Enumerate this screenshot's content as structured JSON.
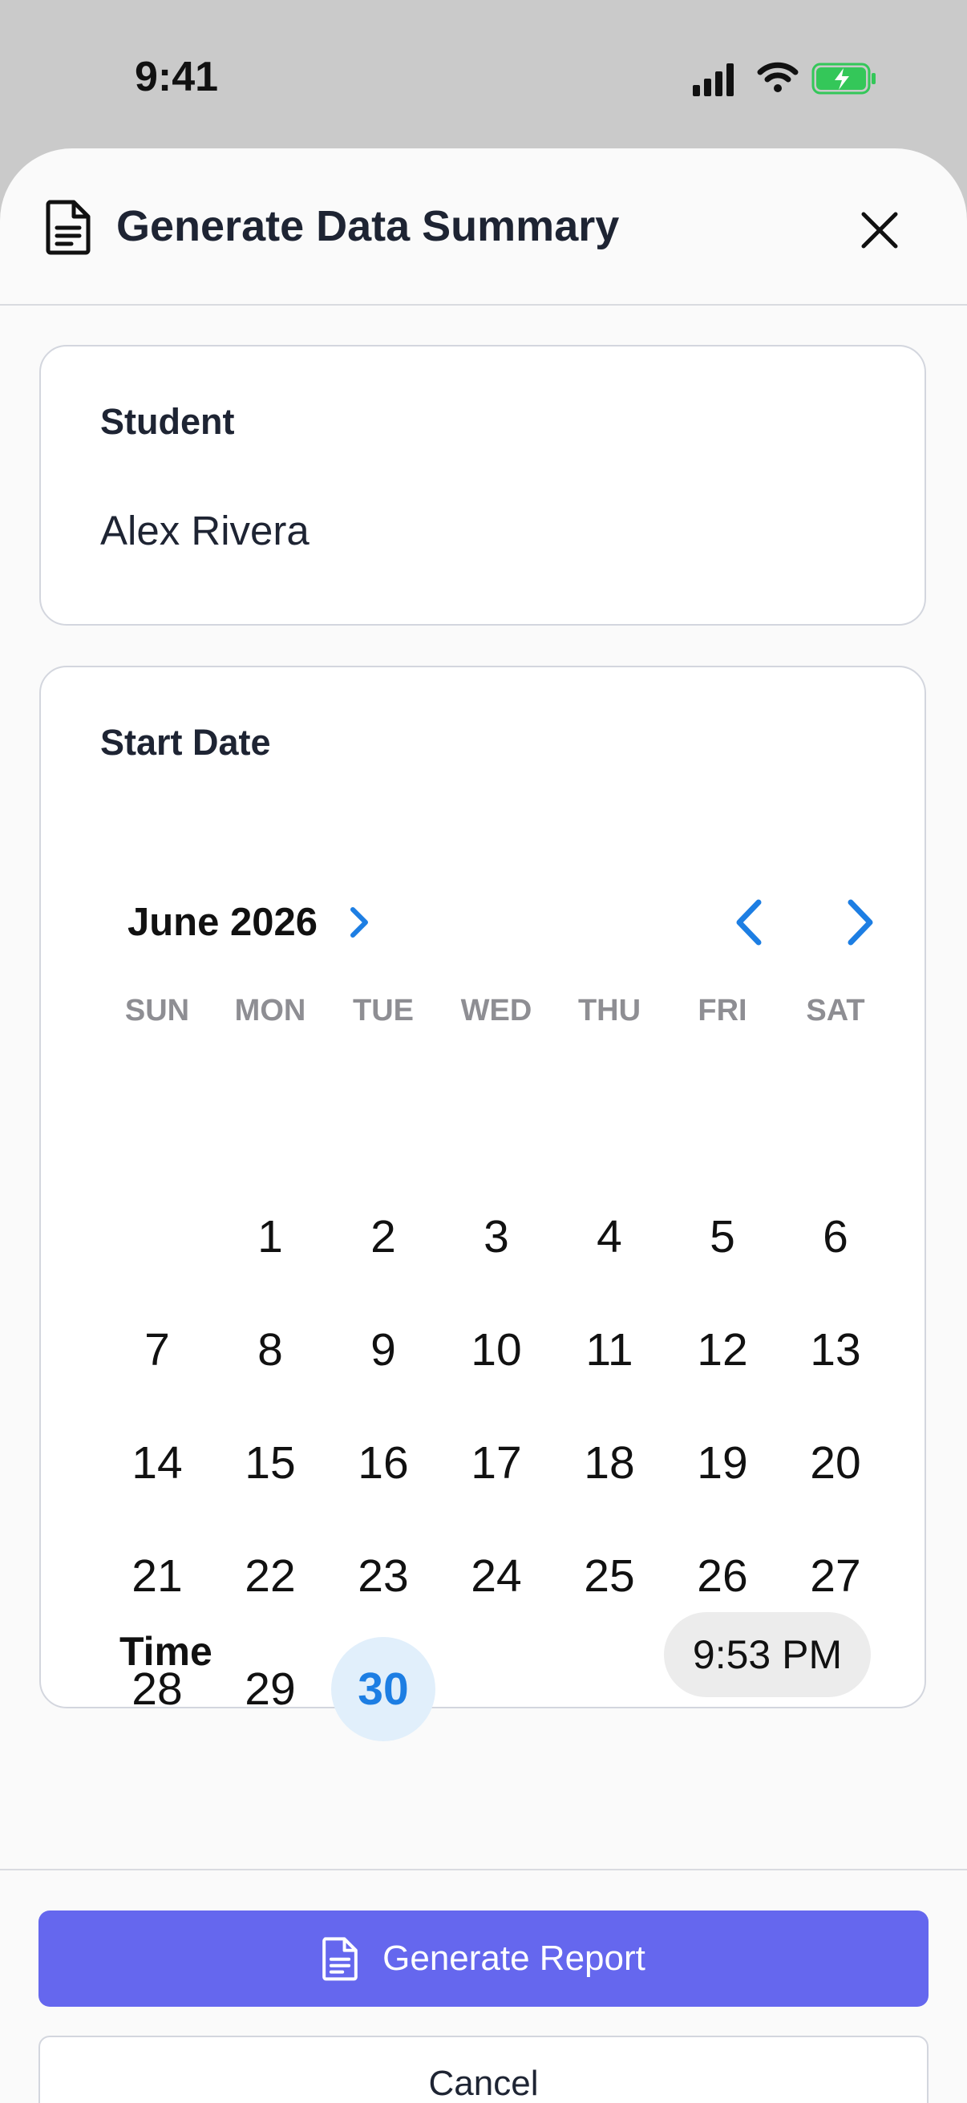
{
  "status_bar": {
    "time": "9:41"
  },
  "sheet": {
    "title": "Generate Data Summary"
  },
  "student": {
    "label": "Student",
    "value": "Alex Rivera"
  },
  "start_date": {
    "label": "Start Date",
    "month": "June 2026",
    "weekdays": [
      "SUN",
      "MON",
      "TUE",
      "WED",
      "THU",
      "FRI",
      "SAT"
    ],
    "days": [
      "1",
      "2",
      "3",
      "4",
      "5",
      "6",
      "7",
      "8",
      "9",
      "10",
      "11",
      "12",
      "13",
      "14",
      "15",
      "16",
      "17",
      "18",
      "19",
      "20",
      "21",
      "22",
      "23",
      "24",
      "25",
      "26",
      "27",
      "28",
      "29",
      "30"
    ],
    "selected_day": "30",
    "time_label": "Time",
    "time_value": "9:53 PM"
  },
  "actions": {
    "generate": "Generate Report",
    "cancel": "Cancel"
  },
  "colors": {
    "accent": "#1d7ee3",
    "primary_button": "#6567ee",
    "selected_bg": "#e1effb"
  }
}
